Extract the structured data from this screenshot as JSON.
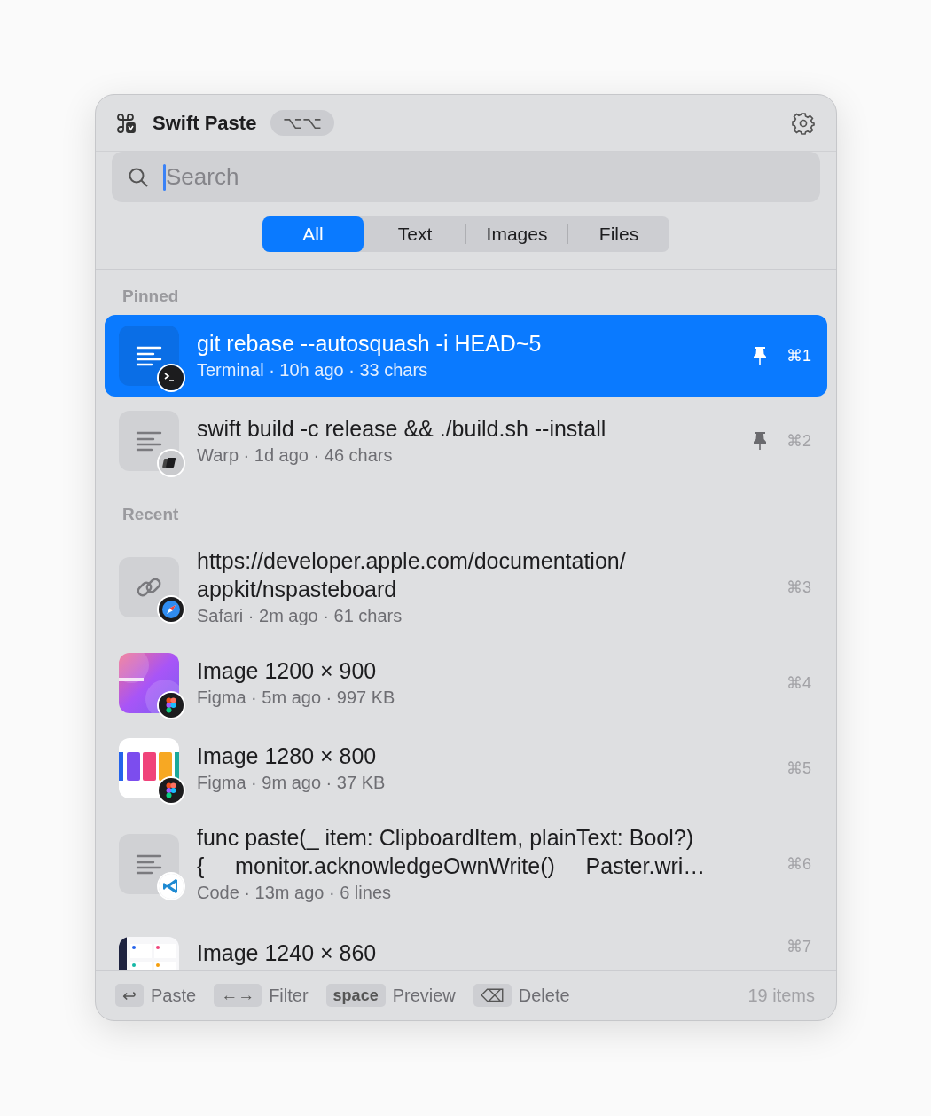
{
  "header": {
    "title": "Swift Paste",
    "shortcut": "⌥⌥"
  },
  "search": {
    "placeholder": "Search"
  },
  "tabs": [
    {
      "label": "All",
      "selected": true
    },
    {
      "label": "Text",
      "selected": false
    },
    {
      "label": "Images",
      "selected": false
    },
    {
      "label": "Files",
      "selected": false
    }
  ],
  "sections": [
    {
      "title": "Pinned",
      "items": [
        {
          "thumbnail": {
            "kind": "text"
          },
          "app_badge": {
            "kind": "terminal"
          },
          "title_lines": [
            "git rebase --autosquash -i HEAD~5"
          ],
          "meta": "Terminal · 10h ago · 33 chars",
          "pinned": true,
          "shortcut": "⌘1",
          "selected": true
        },
        {
          "thumbnail": {
            "kind": "text"
          },
          "app_badge": {
            "kind": "warp"
          },
          "title_lines": [
            "swift build -c release && ./build.sh --install"
          ],
          "meta": "Warp · 1d ago · 46 chars",
          "pinned": true,
          "shortcut": "⌘2",
          "selected": false
        }
      ]
    },
    {
      "title": "Recent",
      "items": [
        {
          "thumbnail": {
            "kind": "link"
          },
          "app_badge": {
            "kind": "safari"
          },
          "title_lines": [
            "https://developer.apple.com/documentation/",
            "appkit/nspasteboard"
          ],
          "meta": "Safari · 2m ago · 61 chars",
          "pinned": false,
          "shortcut": "⌘3",
          "selected": false
        },
        {
          "thumbnail": {
            "kind": "gradient"
          },
          "app_badge": {
            "kind": "figma"
          },
          "title_lines": [
            "Image 1200 × 900"
          ],
          "meta": "Figma · 5m ago · 997 KB",
          "pinned": false,
          "shortcut": "⌘4",
          "selected": false
        },
        {
          "thumbnail": {
            "kind": "swatches"
          },
          "app_badge": {
            "kind": "figma"
          },
          "title_lines": [
            "Image 1280 × 800"
          ],
          "meta": "Figma · 9m ago · 37 KB",
          "pinned": false,
          "shortcut": "⌘5",
          "selected": false
        },
        {
          "thumbnail": {
            "kind": "text"
          },
          "app_badge": {
            "kind": "vscode"
          },
          "title_lines": [
            "func paste(_ item: ClipboardItem, plainText: Bool?)",
            "{     monitor.acknowledgeOwnWrite()     Paster.wri…"
          ],
          "meta": "Code · 13m ago · 6 lines",
          "pinned": false,
          "shortcut": "⌘6",
          "selected": false
        },
        {
          "thumbnail": {
            "kind": "dashboard"
          },
          "title_lines": [
            "Image 1240 × 860"
          ],
          "pinned": false,
          "shortcut": "⌘7",
          "selected": false
        }
      ]
    }
  ],
  "footer": {
    "keys": [
      {
        "kind": "glyph",
        "key": "↩",
        "label": "Paste"
      },
      {
        "kind": "glyph",
        "key": "←→",
        "label": "Filter"
      },
      {
        "kind": "word",
        "key": "space",
        "label": "Preview"
      },
      {
        "kind": "glyph",
        "key": "⌫",
        "label": "Delete"
      }
    ],
    "count": "19 items"
  }
}
